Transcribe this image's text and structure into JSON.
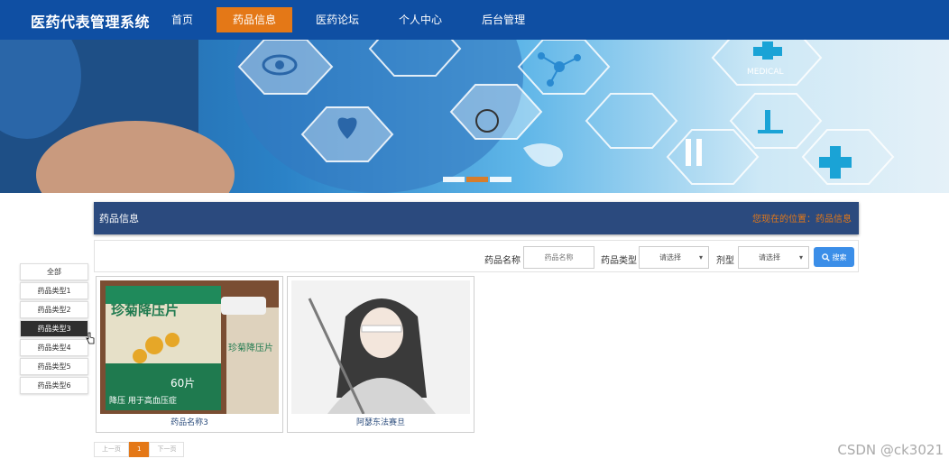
{
  "app": {
    "title": "医药代表管理系统"
  },
  "nav": {
    "items": [
      {
        "label": "首页"
      },
      {
        "label": "药品信息",
        "active": true
      },
      {
        "label": "医药论坛"
      },
      {
        "label": "个人中心"
      },
      {
        "label": "后台管理"
      }
    ]
  },
  "banner": {
    "badge_text": "MEDICAL",
    "slide_count": 3,
    "active_slide": 2
  },
  "section": {
    "title": "药品信息",
    "breadcrumb": "您现在的位置：药品信息"
  },
  "search": {
    "name_label": "药品名称",
    "name_placeholder": "药品名称",
    "type_label": "药品类型",
    "type_value": "请选择",
    "dosage_label": "剂型",
    "dosage_value": "请选择",
    "button_label": "搜索"
  },
  "sidebar": {
    "items": [
      {
        "label": "全部"
      },
      {
        "label": "药品类型1"
      },
      {
        "label": "药品类型2"
      },
      {
        "label": "药品类型3",
        "active": true
      },
      {
        "label": "药品类型4"
      },
      {
        "label": "药品类型5"
      },
      {
        "label": "药品类型6"
      }
    ]
  },
  "products": [
    {
      "name": "药品名称3",
      "image_text": "珍菊降压片",
      "image_sub": "60片",
      "image_caption": "降压 用于高血压症"
    },
    {
      "name": "阿瑟东法赛旦"
    }
  ],
  "pagination": {
    "prev": "上一页",
    "current": "1",
    "next": "下一页"
  },
  "watermark": "CSDN @ck3021",
  "colors": {
    "nav_bg": "#0f4fa3",
    "accent": "#e47817",
    "section_bg": "#2b4a7e",
    "search_button": "#3b8ee8"
  }
}
